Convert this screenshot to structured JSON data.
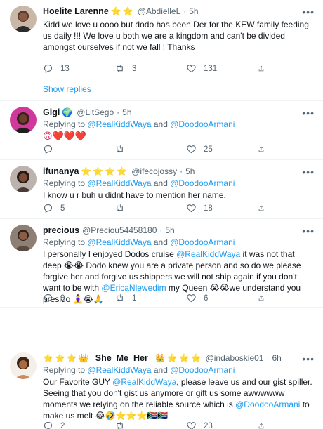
{
  "reply_to_label": "Replying to",
  "and_label": "and",
  "show_replies": "Show replies",
  "more_glyph": "•••",
  "colors": {
    "link": "#1d9bf0",
    "muted": "#536471",
    "text": "#0f1419"
  },
  "tweets": [
    {
      "name": "Hoelite Larenne",
      "handle": "@AbdielleL",
      "time": "5h",
      "reply_users": [
        "@RealKiddWaya",
        "@DoodooArmani"
      ],
      "text": "Kidd we love u oooo but dodo has been Der for the KEW family feeding us daily !!! We love u both we are a kingdom and can't be divided amongst ourselves if not we fall ! Thanks",
      "replies": "13",
      "retweets": "3",
      "likes": "131"
    },
    {
      "name": "Gigi",
      "handle": "@LitSego",
      "time": "5h",
      "reply_users": [
        "@RealKiddWaya",
        "@DoodooArmani"
      ],
      "text": "🙃❤️❤️❤️",
      "replies": "",
      "retweets": "",
      "likes": "25"
    },
    {
      "name": "ifunanya",
      "handle": "@ifecojossy",
      "time": "5h",
      "reply_users": [
        "@RealKiddWaya",
        "@DoodooArmani"
      ],
      "text": "I know u r buh u didnt have to mention her name.",
      "replies": "5",
      "retweets": "",
      "likes": "18"
    },
    {
      "name": "precious",
      "handle": "@Preciou54458180",
      "time": "5h",
      "reply_users": [
        "@RealKiddWaya",
        "@DoodooArmani"
      ],
      "text_parts": {
        "a": "I personally I enjoyed Dodos cruise ",
        "b": "@RealKiddWaya",
        "c": " it was not that deep 😭😭 Dodo knew you are a private person and so do we please forgive her and forgive us shippers we will not ship again if you don't want to be with ",
        "d": "@EricaNlewedim",
        "e": "  my Queen 😭😭we understand you presido 🧘‍♀️😭🙏"
      },
      "replies": "9",
      "retweets": "1",
      "likes": "6"
    },
    {
      "name": "_She_Me_Her_",
      "handle": "@indaboskie01",
      "time": "6h",
      "reply_users": [
        "@RealKiddWaya",
        "@DoodooArmani"
      ],
      "text_parts": {
        "a": "Our Favorite GUY ",
        "b": "@RealKiddWaya",
        "c": ", please leave us and our gist spiller. Seeing that you don't gist us anymore or gift us some awwwwww moments we relying on the reliable source which is ",
        "d": "@DoodooArmani",
        "e": " to make us melt 😂🤣⭐⭐⭐🇿🇦🇿🇦"
      },
      "replies": "2",
      "retweets": "",
      "likes": "23"
    }
  ]
}
